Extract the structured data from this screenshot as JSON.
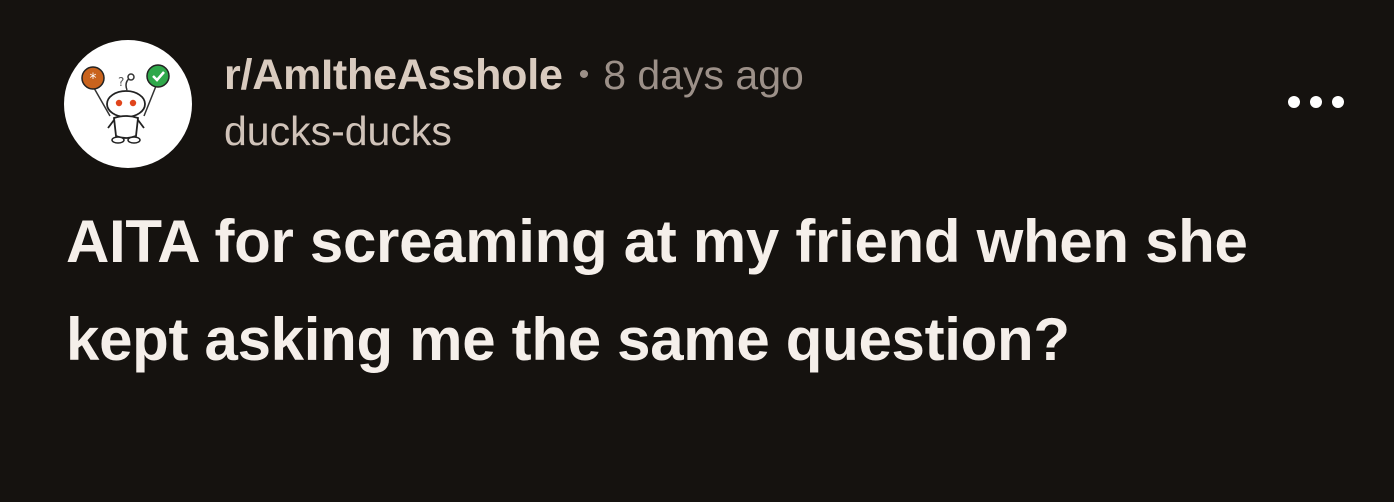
{
  "post": {
    "subreddit": "r/AmItheAsshole",
    "separator": "•",
    "time_ago": "8 days ago",
    "author": "ducks-ducks",
    "title": "AITA for screaming at my friend when she kept asking me the same question?"
  },
  "icons": {
    "avatar": "reddit-snoo-icon",
    "more": "more-options-icon"
  },
  "colors": {
    "background": "#15120f",
    "title": "#f5efea",
    "subreddit": "#d9cbbf",
    "muted": "#9c9088"
  }
}
